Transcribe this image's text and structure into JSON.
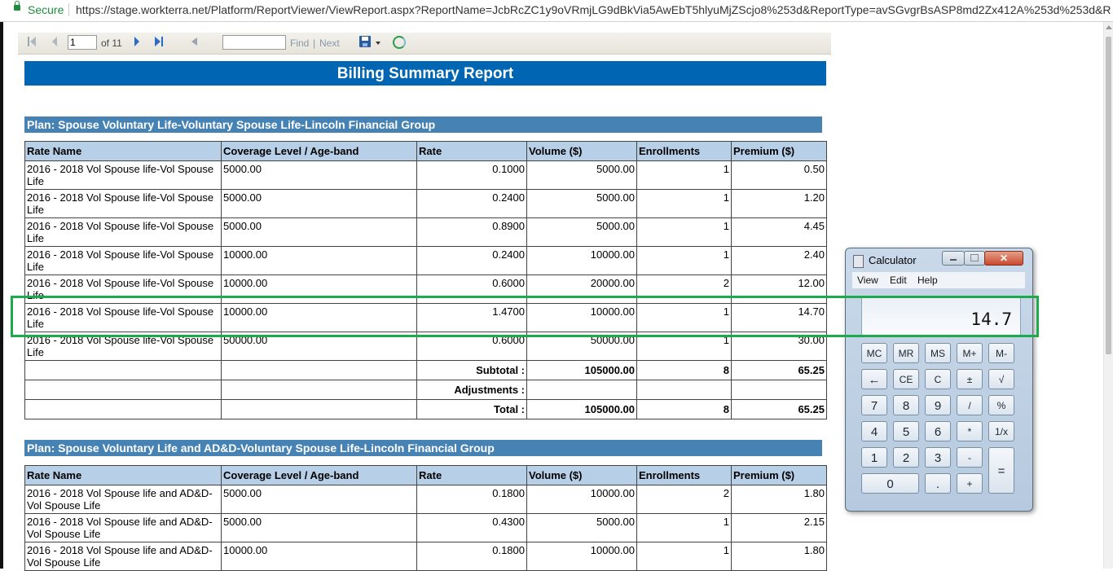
{
  "browser": {
    "secure_label": "Secure",
    "url": "https://stage.workterra.net/Platform/ReportViewer/ViewReport.aspx?ReportName=JcbRcZC1y9oVRmjLG9dBkVia5AwEbT5hlyuMjZScjo8%253d&ReportType=avSGvgrBsASP8md2Zx412A%253d%253d&Rep..."
  },
  "toolbar": {
    "page_value": "1",
    "of_label": "of 11",
    "find_label": "Find",
    "pipe": "|",
    "next_label": "Next"
  },
  "report": {
    "title": "Billing Summary Report",
    "headers": [
      "Rate Name",
      "Coverage Level / Age-band",
      "Rate",
      "Volume ($)",
      "Enrollments",
      "Premium ($)"
    ],
    "plan1": {
      "name": "Plan: Spouse Voluntary Life-Voluntary Spouse Life-Lincoln Financial Group",
      "rows": [
        [
          "2016 - 2018 Vol Spouse life-Vol Spouse Life",
          "5000.00",
          "0.1000",
          "5000.00",
          "1",
          "0.50"
        ],
        [
          "2016 - 2018 Vol Spouse life-Vol Spouse Life",
          "5000.00",
          "0.2400",
          "5000.00",
          "1",
          "1.20"
        ],
        [
          "2016 - 2018 Vol Spouse life-Vol Spouse Life",
          "5000.00",
          "0.8900",
          "5000.00",
          "1",
          "4.45"
        ],
        [
          "2016 - 2018 Vol Spouse life-Vol Spouse Life",
          "10000.00",
          "0.2400",
          "10000.00",
          "1",
          "2.40"
        ],
        [
          "2016 - 2018 Vol Spouse life-Vol Spouse Life",
          "10000.00",
          "0.6000",
          "20000.00",
          "2",
          "12.00"
        ],
        [
          "2016 - 2018 Vol Spouse life-Vol Spouse Life",
          "10000.00",
          "1.4700",
          "10000.00",
          "1",
          "14.70"
        ],
        [
          "2016 - 2018 Vol Spouse life-Vol Spouse Life",
          "50000.00",
          "0.6000",
          "50000.00",
          "1",
          "30.00"
        ]
      ],
      "subtotal_label": "Subtotal :",
      "subtotal": [
        "105000.00",
        "8",
        "65.25"
      ],
      "adjustments_label": "Adjustments :",
      "total_label": "Total :",
      "total": [
        "105000.00",
        "8",
        "65.25"
      ]
    },
    "plan2": {
      "name": "Plan: Spouse Voluntary Life and AD&D-Voluntary Spouse Life-Lincoln Financial Group",
      "rows": [
        [
          "2016 - 2018 Vol Spouse life and AD&D-Vol Spouse Life",
          "5000.00",
          "0.1800",
          "10000.00",
          "2",
          "1.80"
        ],
        [
          "2016 - 2018 Vol Spouse life and AD&D-Vol Spouse Life",
          "5000.00",
          "0.4300",
          "5000.00",
          "1",
          "2.15"
        ],
        [
          "2016 - 2018 Vol Spouse life and AD&D-Vol Spouse Life",
          "10000.00",
          "0.1800",
          "10000.00",
          "1",
          "1.80"
        ]
      ]
    }
  },
  "calculator": {
    "title": "Calculator",
    "close_glyph": "✕",
    "menu": [
      "View",
      "Edit",
      "Help"
    ],
    "display": "14.7",
    "buttons": [
      [
        "MC",
        "MR",
        "MS",
        "M+",
        "M-"
      ],
      [
        "←",
        "CE",
        "C",
        "±",
        "√"
      ],
      [
        "7",
        "8",
        "9",
        "/",
        "%"
      ],
      [
        "4",
        "5",
        "6",
        "*",
        "1/x"
      ],
      [
        "1",
        "2",
        "3",
        "-",
        "="
      ],
      [
        "0",
        ".",
        "+"
      ]
    ]
  },
  "colors": {
    "title_bar": "#0066b3",
    "plan_bar": "#4682b4",
    "header_row": "#b8cfe8",
    "highlight": "#1daa4a"
  }
}
